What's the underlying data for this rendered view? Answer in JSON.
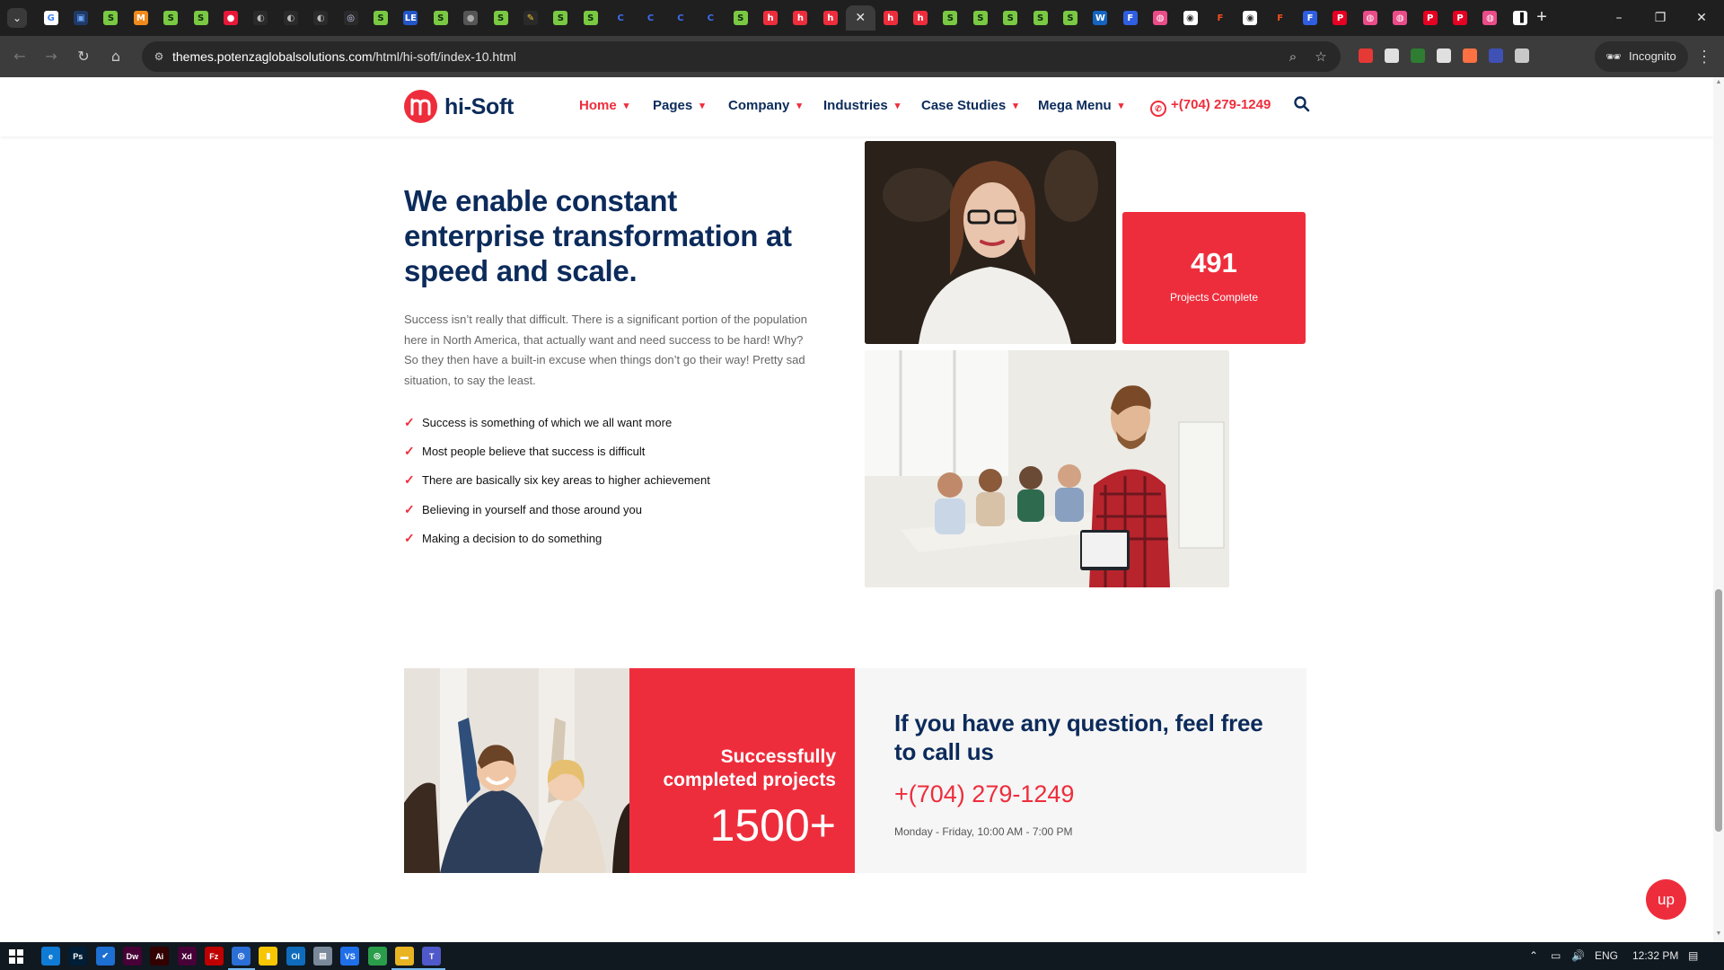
{
  "browser": {
    "tabs": [
      {
        "label": "G",
        "color": "#ffffff",
        "text": "#4285f4"
      },
      {
        "label": "▣",
        "color": "#1e3a66",
        "text": "#6fa8ff"
      },
      {
        "label": "S",
        "color": "#7ac943",
        "text": "#0f2a0f"
      },
      {
        "label": "M",
        "color": "#f18a1c",
        "text": "#ffffff"
      },
      {
        "label": "S",
        "color": "#7ac943",
        "text": "#0f2a0f"
      },
      {
        "label": "S",
        "color": "#7ac943",
        "text": "#0f2a0f"
      },
      {
        "label": "●",
        "color": "#e8173a",
        "text": "#ffffff"
      },
      {
        "label": "◐",
        "color": "#2a2a2a",
        "text": "#bbbbbb"
      },
      {
        "label": "◐",
        "color": "#2a2a2a",
        "text": "#bbbbbb"
      },
      {
        "label": "◐",
        "color": "#2a2a2a",
        "text": "#bbbbbb"
      },
      {
        "label": "◎",
        "color": "#2a2a2a",
        "text": "#cfd8ff"
      },
      {
        "label": "S",
        "color": "#7ac943",
        "text": "#0f2a0f"
      },
      {
        "label": "LE",
        "color": "#2456c8",
        "text": "#ffffff"
      },
      {
        "label": "S",
        "color": "#7ac943",
        "text": "#0f2a0f"
      },
      {
        "label": "●",
        "color": "#555555",
        "text": "#aaaaaa"
      },
      {
        "label": "S",
        "color": "#7ac943",
        "text": "#0f2a0f"
      },
      {
        "label": "✎",
        "color": "#2a2a2a",
        "text": "#f2c230"
      },
      {
        "label": "S",
        "color": "#7ac943",
        "text": "#0f2a0f"
      },
      {
        "label": "S",
        "color": "#7ac943",
        "text": "#0f2a0f"
      },
      {
        "label": "C",
        "color": "#1f1f1f",
        "text": "#3b6df5"
      },
      {
        "label": "C",
        "color": "#1f1f1f",
        "text": "#3b6df5"
      },
      {
        "label": "C",
        "color": "#1f1f1f",
        "text": "#3b6df5"
      },
      {
        "label": "C",
        "color": "#1f1f1f",
        "text": "#3b6df5"
      },
      {
        "label": "S",
        "color": "#7ac943",
        "text": "#0f2a0f"
      },
      {
        "label": "h",
        "color": "#ee2d3c",
        "text": "#ffffff"
      },
      {
        "label": "h",
        "color": "#ee2d3c",
        "text": "#ffffff"
      },
      {
        "label": "h",
        "color": "#ee2d3c",
        "text": "#ffffff"
      },
      {
        "label": "✕",
        "color": "#3c3c3c",
        "text": "#e8e8e8",
        "active": true
      },
      {
        "label": "h",
        "color": "#ee2d3c",
        "text": "#ffffff"
      },
      {
        "label": "h",
        "color": "#ee2d3c",
        "text": "#ffffff"
      },
      {
        "label": "S",
        "color": "#7ac943",
        "text": "#0f2a0f"
      },
      {
        "label": "S",
        "color": "#7ac943",
        "text": "#0f2a0f"
      },
      {
        "label": "S",
        "color": "#7ac943",
        "text": "#0f2a0f"
      },
      {
        "label": "S",
        "color": "#7ac943",
        "text": "#0f2a0f"
      },
      {
        "label": "S",
        "color": "#7ac943",
        "text": "#0f2a0f"
      },
      {
        "label": "W",
        "color": "#1565c0",
        "text": "#ffffff"
      },
      {
        "label": "F",
        "color": "#2f5fe0",
        "text": "#ffffff"
      },
      {
        "label": "◍",
        "color": "#ea4c89",
        "text": "#ffffff"
      },
      {
        "label": "◉",
        "color": "#ffffff",
        "text": "#333333"
      },
      {
        "label": "F",
        "color": "#1f1f1f",
        "text": "#f24e1e"
      },
      {
        "label": "◉",
        "color": "#ffffff",
        "text": "#333333"
      },
      {
        "label": "F",
        "color": "#1f1f1f",
        "text": "#f24e1e"
      },
      {
        "label": "F",
        "color": "#2f5fe0",
        "text": "#ffffff"
      },
      {
        "label": "P",
        "color": "#e60023",
        "text": "#ffffff"
      },
      {
        "label": "◍",
        "color": "#ea4c89",
        "text": "#ffffff"
      },
      {
        "label": "◍",
        "color": "#ea4c89",
        "text": "#ffffff"
      },
      {
        "label": "P",
        "color": "#e60023",
        "text": "#ffffff"
      },
      {
        "label": "P",
        "color": "#e60023",
        "text": "#ffffff"
      },
      {
        "label": "◍",
        "color": "#ea4c89",
        "text": "#ffffff"
      },
      {
        "label": "▐",
        "color": "#ffffff",
        "text": "#111111"
      }
    ],
    "new_tab": "+",
    "window_controls": {
      "minimize": "–",
      "restore": "❐",
      "close": "✕"
    },
    "url_host": "themes.potenzaglobalsolutions.com",
    "url_path": "/html/hi-soft/index-10.html",
    "incognito_label": "Incognito",
    "extensions": [
      "#e53935",
      "#e0e0e0",
      "#2e7d32",
      "#e0e0e0",
      "#ff7043",
      "#3f51b5",
      "#c8c8c8"
    ]
  },
  "site": {
    "logo_text": "hi-Soft",
    "nav": [
      {
        "label": "Home",
        "active": true
      },
      {
        "label": "Pages"
      },
      {
        "label": "Company"
      },
      {
        "label": "Industries"
      },
      {
        "label": "Case Studies"
      },
      {
        "label": "Mega Menu"
      }
    ],
    "phone": "+(704) 279-1249",
    "icons": {
      "whatsapp": "whatsapp-icon",
      "search": "search-icon"
    }
  },
  "about": {
    "title": "We enable constant enterprise transformation at speed and scale.",
    "paragraph": "Success isn’t really that difficult. There is a significant portion of the population here in North America, that actually want and need success to be hard! Why? So they then have a built-in excuse when things don’t go their way! Pretty sad situation, to say the least.",
    "features": [
      "Success is something of which we all want more",
      "Most people believe that success is difficult",
      "There are basically six key areas to higher achievement",
      "Believing in yourself and those around you",
      "Making a decision to do something"
    ],
    "stat_number": "491",
    "stat_label": "Projects Complete"
  },
  "counter": {
    "title": "Successfully completed projects",
    "number": "1500+"
  },
  "contact": {
    "title": "If you have any question, feel free to call us",
    "phone": "+(704) 279-1249",
    "hours": "Monday - Friday, 10:00 AM - 7:00 PM"
  },
  "up_label": "up",
  "taskbar": {
    "apps": [
      {
        "label": "e",
        "color": "#0f7bd5"
      },
      {
        "label": "Ps",
        "color": "#001e36"
      },
      {
        "label": "✔",
        "color": "#1d6fd1"
      },
      {
        "label": "Dw",
        "color": "#470137"
      },
      {
        "label": "Ai",
        "color": "#330000"
      },
      {
        "label": "Xd",
        "color": "#470137"
      },
      {
        "label": "Fz",
        "color": "#bf0000"
      },
      {
        "label": "◎",
        "color": "#2b6fd6",
        "active": true
      },
      {
        "label": "▮",
        "color": "#f7c600"
      },
      {
        "label": "Ol",
        "color": "#0f6cbd"
      },
      {
        "label": "▤",
        "color": "#7a8a9a"
      },
      {
        "label": "VS",
        "color": "#1f6feb"
      },
      {
        "label": "◎",
        "color": "#2a9d4a"
      },
      {
        "label": "▬",
        "color": "#e8b423",
        "active": true
      },
      {
        "label": "T",
        "color": "#5059c9",
        "active": true
      }
    ],
    "language": "ENG",
    "time": "12:32 PM"
  },
  "colors": {
    "brand_red": "#ee2d3c",
    "brand_navy": "#0c2b5b"
  }
}
